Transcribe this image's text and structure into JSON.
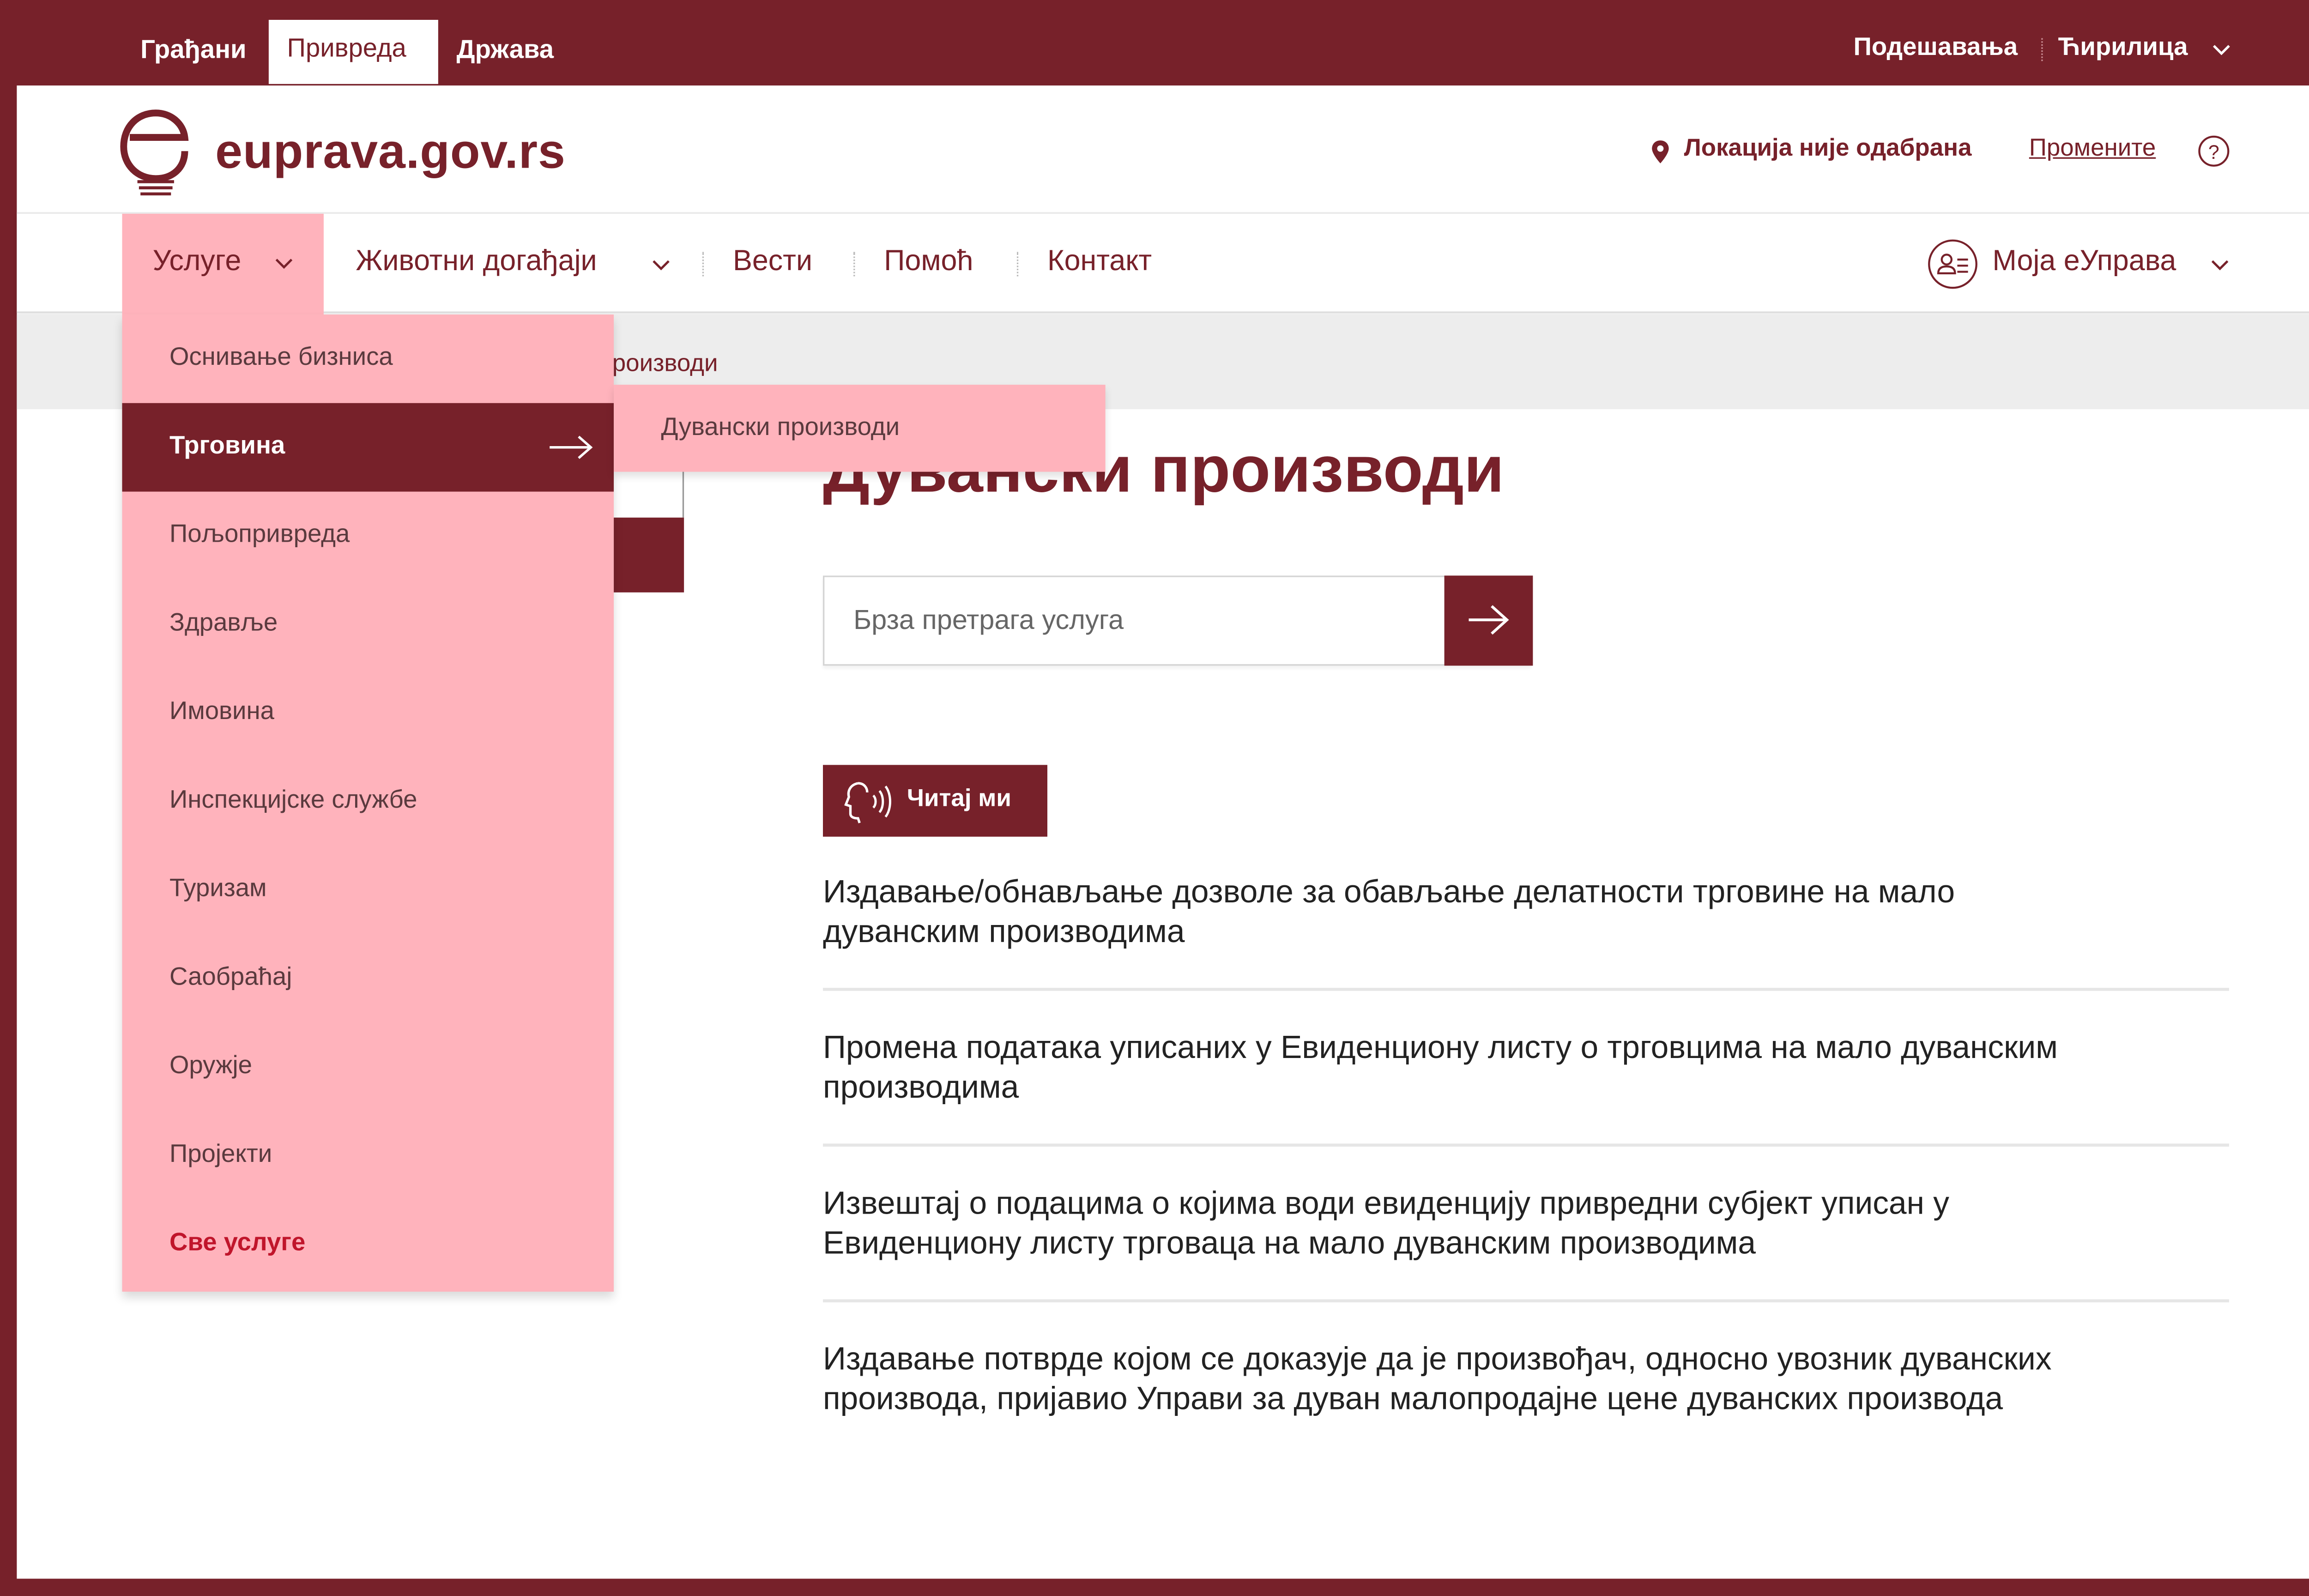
{
  "topbar": {
    "tabs": [
      {
        "label": "Грађани"
      },
      {
        "label": "Привреда"
      },
      {
        "label": "Држава"
      }
    ],
    "settings_label": "Подешавања",
    "language_label": "Ћирилица"
  },
  "header": {
    "logo_text": "euprava.gov.rs",
    "location_label": "Локација није одабрана",
    "change_label": "Промените",
    "help_icon": "question-circle-icon"
  },
  "nav": {
    "items": [
      {
        "label": "Услуге"
      },
      {
        "label": "Животни догађаји"
      },
      {
        "label": "Вести"
      },
      {
        "label": "Помоћ"
      },
      {
        "label": "Контакт"
      }
    ],
    "account_label": "Моја еУправа"
  },
  "breadcrumb": {
    "current": "роизводи"
  },
  "dropdown": {
    "items": [
      {
        "label": "Оснивање бизниса"
      },
      {
        "label": "Трговина"
      },
      {
        "label": "Пољопривреда"
      },
      {
        "label": "Здравље"
      },
      {
        "label": "Имовина"
      },
      {
        "label": "Инспекцијске службе"
      },
      {
        "label": "Туризам"
      },
      {
        "label": "Саобраћај"
      },
      {
        "label": "Оружје"
      },
      {
        "label": "Пројекти"
      },
      {
        "label": "Све услуге"
      }
    ],
    "active_index": 1,
    "submenu": [
      {
        "label": "Дувански производи"
      }
    ]
  },
  "main": {
    "title": "Дувански производи",
    "search_placeholder": "Брза претрага услуга",
    "read_label": "Читај ми",
    "services": [
      {
        "label": "Издавање/обнављање дозволе за обављање делатности трговине на мало дуванским производима"
      },
      {
        "label": "Промена података уписаних у Евиденциону листу о трговцима на мало дуванским производима"
      },
      {
        "label": "Извештај о подацима о којима води евиденцију привредни субјект уписан у Евиденциону листу трговаца на мало дуванским производима"
      },
      {
        "label": "Издавање потврде којом се доказује да је произвођач, односно увозник дуванских производа, пријавио Управи за дуван малопродајне цене дуванских производа"
      }
    ]
  },
  "colors": {
    "brand": "#77212a",
    "dropdown_bg": "#ffb3bc",
    "all_services": "#c0152b"
  }
}
